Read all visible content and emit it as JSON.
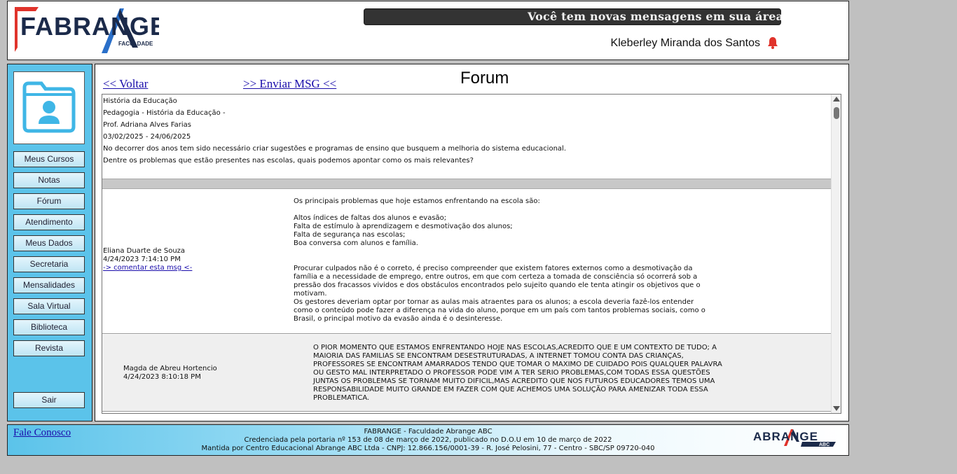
{
  "header": {
    "logo_text": "FABRANGE",
    "logo_sub": "FACULDADE",
    "marquee": "Você tem novas mensagens em sua área de",
    "user_name": "Kleberley Miranda dos Santos",
    "bell_icon": "bell-icon",
    "accent_red": "#e0332b"
  },
  "sidebar": {
    "avatar_icon": "user-folder-icon",
    "items": [
      {
        "label": "Meus Cursos"
      },
      {
        "label": "Notas"
      },
      {
        "label": "Fórum"
      },
      {
        "label": "Atendimento"
      },
      {
        "label": "Meus Dados"
      },
      {
        "label": "Secretaria"
      },
      {
        "label": "Mensalidades"
      },
      {
        "label": "Sala Virtual"
      },
      {
        "label": "Biblioteca"
      },
      {
        "label": "Revista"
      }
    ],
    "logout": "Sair"
  },
  "main": {
    "back_link": "<< Voltar",
    "send_link": ">> Enviar MSG <<",
    "title": "Forum",
    "topic": {
      "discipline": "História da Educação",
      "course": "Pedagogia - História da Educação -",
      "professor": "Prof. Adriana Alves Farias",
      "period": "03/02/2025 - 24/06/2025",
      "intro": "No decorrer dos anos tem sido necessário criar sugestões e programas de ensino que busquem a melhoria do sistema educacional.",
      "question": "Dentre os problemas que estão presentes nas escolas, quais podemos apontar como os mais relevantes?"
    },
    "posts": [
      {
        "author": "Eliana Duarte de Souza",
        "date": "4/24/2023 7:14:10 PM",
        "comment": "-> comentar esta msg <-",
        "message": "Os principais problemas que hoje estamos enfrentando na escola são:\n\nAltos índices de faltas dos alunos e evasão;\nFalta de estímulo à aprendizagem e desmotivação dos alunos;\nFalta de segurança nas escolas;\nBoa conversa com alunos e família.\n\n\nProcurar culpados não é o correto, é preciso compreender que existem fatores externos como a desmotivação da\nfamília e a necessidade de emprego, entre outros, em que com certeza a tomada de consciência só ocorrerá sob a\npressão dos fracassos vividos e dos obstáculos encontrados pelo sujeito quando ele tenta atingir os objetivos que o\nmotivam.\nOs gestores deveriam optar por tornar as aulas mais atraentes para os alunos; a escola deveria fazê-los entender\ncomo o conteúdo pode fazer a diferença na vida do aluno, porque em um país com tantos problemas sociais, como o\nBrasil, o principal motivo da evasão ainda é o desinteresse."
      },
      {
        "author": "Magda de Abreu Hortencio",
        "date": "4/24/2023 8:10:18 PM",
        "message": "O PIOR MOMENTO QUE ESTAMOS ENFRENTANDO HOJE NAS ESCOLAS,ACREDITO QUE E UM CONTEXTO DE TUDO; A\nMAIORIA DAS FAMILIAS SE ENCONTRAM DESESTRUTURADAS, A INTERNET TOMOU CONTA DAS CRIANÇAS,\nPROFESSORES SE ENCONTRAM AMARRADOS TENDO QUE TOMAR O MAXIMO DE CUIDADO POIS QUALQUER PALAVRA\nOU GESTO MAL INTERPRETADO O PROFESSOR PODE VIM A TER SERIO PROBLEMAS,COM TODAS ESSA QUESTÕES\nJUNTAS OS PROBLEMAS SE TORNAM MUITO DIFICIL,MAS ACREDITO QUE NOS FUTUROS EDUCADORES TEMOS UMA\nRESPONSABILIDADE MUITO GRANDE EM FAZER COM QUE ACHEMOS UMA SOLUÇÃO PARA AMENIZAR TODA ESSA\nPROBLEMATICA."
      }
    ]
  },
  "footer": {
    "contact": "Fale Conosco",
    "line1": "FABRANGE - Faculdade Abrange ABC",
    "line2": "Credenciada pela portaria nº 153 de 08 de março de 2022, publicado no D.O.U em 10 de março de 2022",
    "line3": "Mantida por Centro Educacional Abrange ABC Ltda - CNPJ: 12.866.156/0001-39 - R. José Pelosini, 77 - Centro - SBC/SP 09720-040",
    "logo_text": "ABRANGE",
    "logo_sub": "ABC"
  }
}
